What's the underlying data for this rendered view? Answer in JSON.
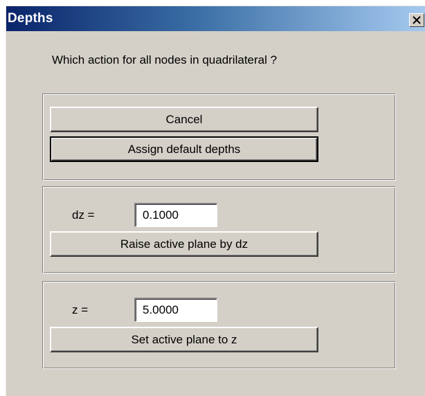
{
  "window": {
    "title": "Depths",
    "close_glyph": "close-icon"
  },
  "prompt": "Which action for all nodes in quadrilateral ?",
  "group1": {
    "cancel_label": "Cancel",
    "assign_label": "Assign default depths"
  },
  "group2": {
    "dz_label": "dz =",
    "dz_value": "0.1000",
    "raise_label": "Raise active plane by dz"
  },
  "group3": {
    "z_label": "z =",
    "z_value": "5.0000",
    "set_label": "Set active plane to z"
  },
  "colors": {
    "titlebar_start": "#0a246a",
    "titlebar_end": "#a6caf0",
    "face": "#d4d0c8"
  }
}
